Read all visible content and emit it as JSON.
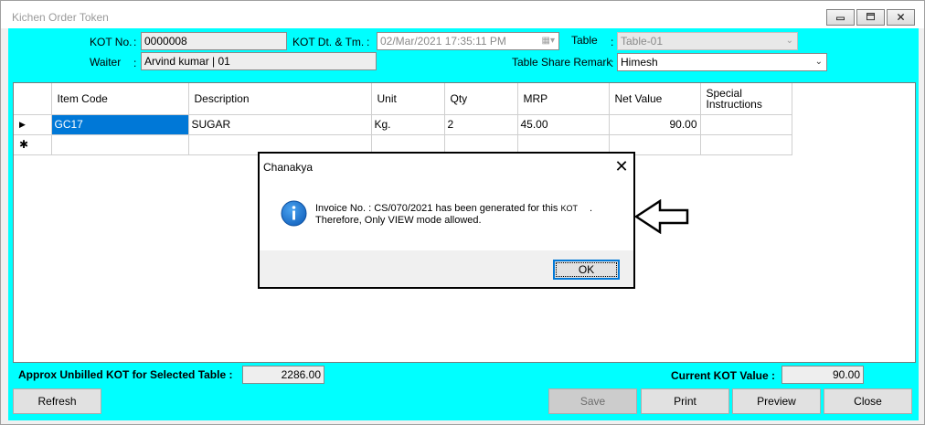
{
  "window": {
    "title": "Kichen Order Token",
    "icons": [
      "minimize-icon",
      "maximize-icon",
      "close-icon"
    ]
  },
  "header": {
    "kot_no_label": "KOT No.",
    "kot_no_sep": ":",
    "kot_no_value": "0000008",
    "kot_dt_label": "KOT Dt. & Tm.",
    "kot_dt_sep": ":",
    "kot_dt_value": "02/Mar/2021 17:35:11 PM",
    "table_label": "Table",
    "table_sep": ":",
    "table_value": "Table-01",
    "waiter_label": "Waiter",
    "waiter_sep": ":",
    "waiter_value": "Arvind kumar | 01",
    "share_label": "Table Share Remark",
    "share_sep": ":",
    "share_value": "Himesh"
  },
  "grid": {
    "columns": [
      "Item Code",
      "Description",
      "Unit",
      "Qty",
      "MRP",
      "Net Value",
      "Special Instructions"
    ],
    "rows": [
      {
        "marker": "▶",
        "item_code": "GC17",
        "description": "SUGAR",
        "unit": "Kg.",
        "qty": "2",
        "mrp": "45.00",
        "net_value": "90.00",
        "special": ""
      }
    ],
    "new_row_marker": "✱"
  },
  "footer": {
    "unbilled_label": "Approx Unbilled KOT for Selected Table :",
    "unbilled_value": "2286.00",
    "current_label": "Current KOT Value :",
    "current_value": "90.00",
    "buttons": {
      "refresh": "Refresh",
      "save": "Save",
      "print": "Print",
      "preview": "Preview",
      "close": "Close"
    }
  },
  "dialog": {
    "title": "Chanakya",
    "close_glyph": "✕",
    "message_line1_a": "Invoice No. : CS/070/2021 has been generated for this",
    "message_line1_b": "KOT",
    "message_line1_c": ".",
    "message_line2": "Therefore, Only VIEW mode allowed.",
    "ok_label": "OK",
    "icon": "info-icon"
  },
  "annotation": {
    "icon": "left-arrow-icon"
  }
}
